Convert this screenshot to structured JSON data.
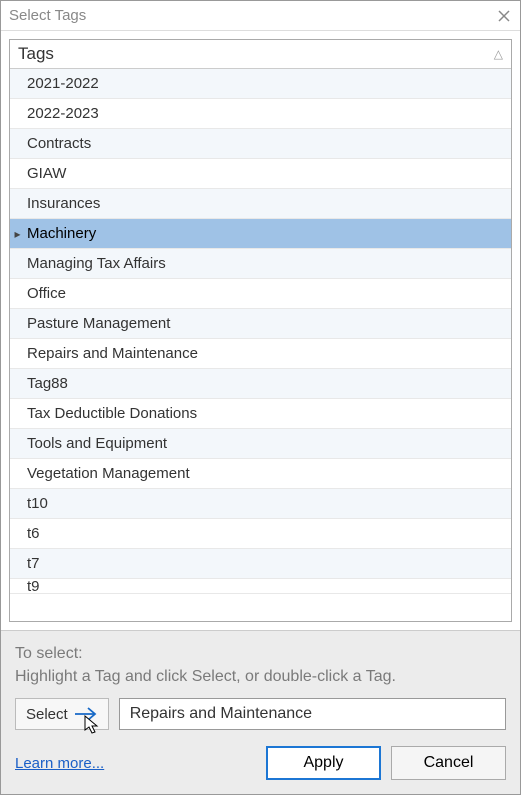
{
  "title": "Select Tags",
  "headerLabel": "Tags",
  "tags": [
    "2021-2022",
    "2022-2023",
    "Contracts",
    "GIAW",
    "Insurances",
    "Machinery",
    "Managing Tax Affairs",
    "Office",
    "Pasture Management",
    "Repairs and Maintenance",
    "Tag88",
    "Tax Deductible Donations",
    "Tools and Equipment",
    "Vegetation Management",
    "t10",
    "t6",
    "t7",
    "t9"
  ],
  "selectedIndex": 5,
  "hintTitle": "To select:",
  "hintBody": "Highlight a Tag and click Select, or double-click a Tag.",
  "selectButton": "Select",
  "selectedValue": "Repairs and Maintenance",
  "learnMore": "Learn more...",
  "applyButton": "Apply",
  "cancelButton": "Cancel"
}
